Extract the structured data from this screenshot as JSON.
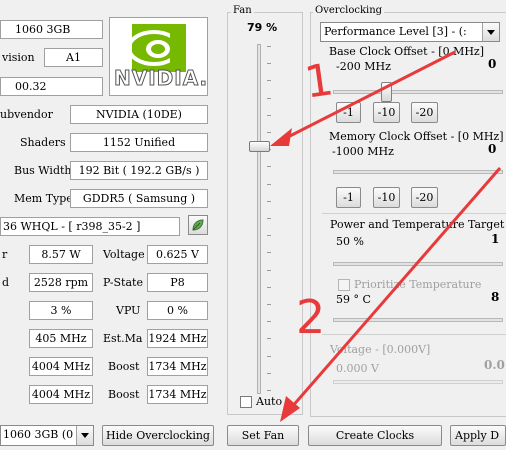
{
  "info": {
    "card_name": "1060 3GB",
    "revision_label": "vision",
    "revision": "A1",
    "bios": "00.32",
    "subvendor_label": "ubvendor",
    "subvendor": "NVIDIA (10DE)",
    "shaders_label": "Shaders",
    "shaders": "1152 Unified",
    "bus_width_label": "Bus Width",
    "bus_width": "192 Bit ( 192.2 GB/s )",
    "mem_type_label": "Mem Type",
    "mem_type": "GDDR5 ( Samsung )",
    "driver": "36 WHQL - [ r398_35-2 ]",
    "power_label": "r",
    "power": "8.57 W",
    "voltage_label": "Voltage",
    "voltage": "0.625 V",
    "fan_rpm_label": "d",
    "fan_rpm": "2528 rpm",
    "pstate_label": "P-State",
    "pstate": "P8",
    "load": "3 %",
    "vpu_label": "VPU",
    "vpu": "0 %",
    "clk1": "405 MHz",
    "estma_label": "Est.Ma",
    "estma": "1924 MHz",
    "mem1": "4004 MHz",
    "boost1_label": "Boost",
    "boost1": "1734 MHz",
    "mem2": "4004 MHz",
    "boost2_label": "Boost",
    "boost2": "1734 MHz",
    "logo_text": "NVIDIA."
  },
  "fan": {
    "title": "Fan",
    "percent": "79 %",
    "level": 0.79,
    "auto_label": "Auto"
  },
  "oc": {
    "title": "Overclocking",
    "profile": "Performance Level [3] - (:",
    "base_label": "Base Clock Offset - [0 MHz]",
    "base_min": "-200 MHz",
    "base_max": "0",
    "mem_label": "Memory Clock Offset - [0 MHz]",
    "mem_min": "-1000 MHz",
    "mem_max": "0",
    "step_1": "-1",
    "step_10": "-10",
    "step_20": "-20",
    "power_label": "Power and Temperature Target",
    "power_val": "50 %",
    "power_max": "1",
    "prioritize_label": "Prioritize Temperature",
    "temp_val": "59 ° C",
    "temp_max": "8",
    "voltage_label": "Voltage - [0.000V]",
    "voltage_val": "0.000 V",
    "voltage_max": "0.0"
  },
  "footer": {
    "gpu_select": "1060 3GB (0",
    "hide_oc": "Hide Overclocking",
    "set_fan": "Set Fan",
    "create_clocks": "Create Clocks",
    "apply": "Apply D"
  },
  "annotations": {
    "step1": "1",
    "step2": "2"
  },
  "colors": {
    "arrow": "#e83a3a",
    "nvidia_green": "#76b900"
  }
}
